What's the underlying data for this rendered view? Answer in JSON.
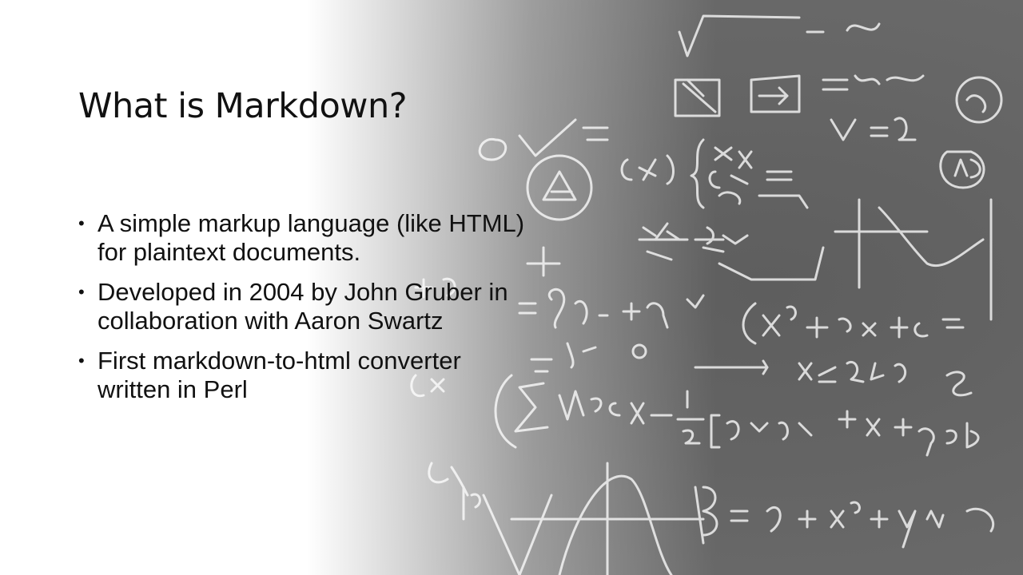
{
  "slide": {
    "title": "What is Markdown?",
    "bullets": [
      "A simple markup language (like HTML) for plaintext documents.",
      "Developed in 2004 by John Gruber in collaboration with Aaron Swartz",
      "First markdown-to-html converter written in Perl"
    ],
    "background_image": "chalkboard-math-formulas",
    "colors": {
      "text": "#111111",
      "chalkboard": "#5a5a5a",
      "chalk": "#f2f2f2"
    }
  }
}
